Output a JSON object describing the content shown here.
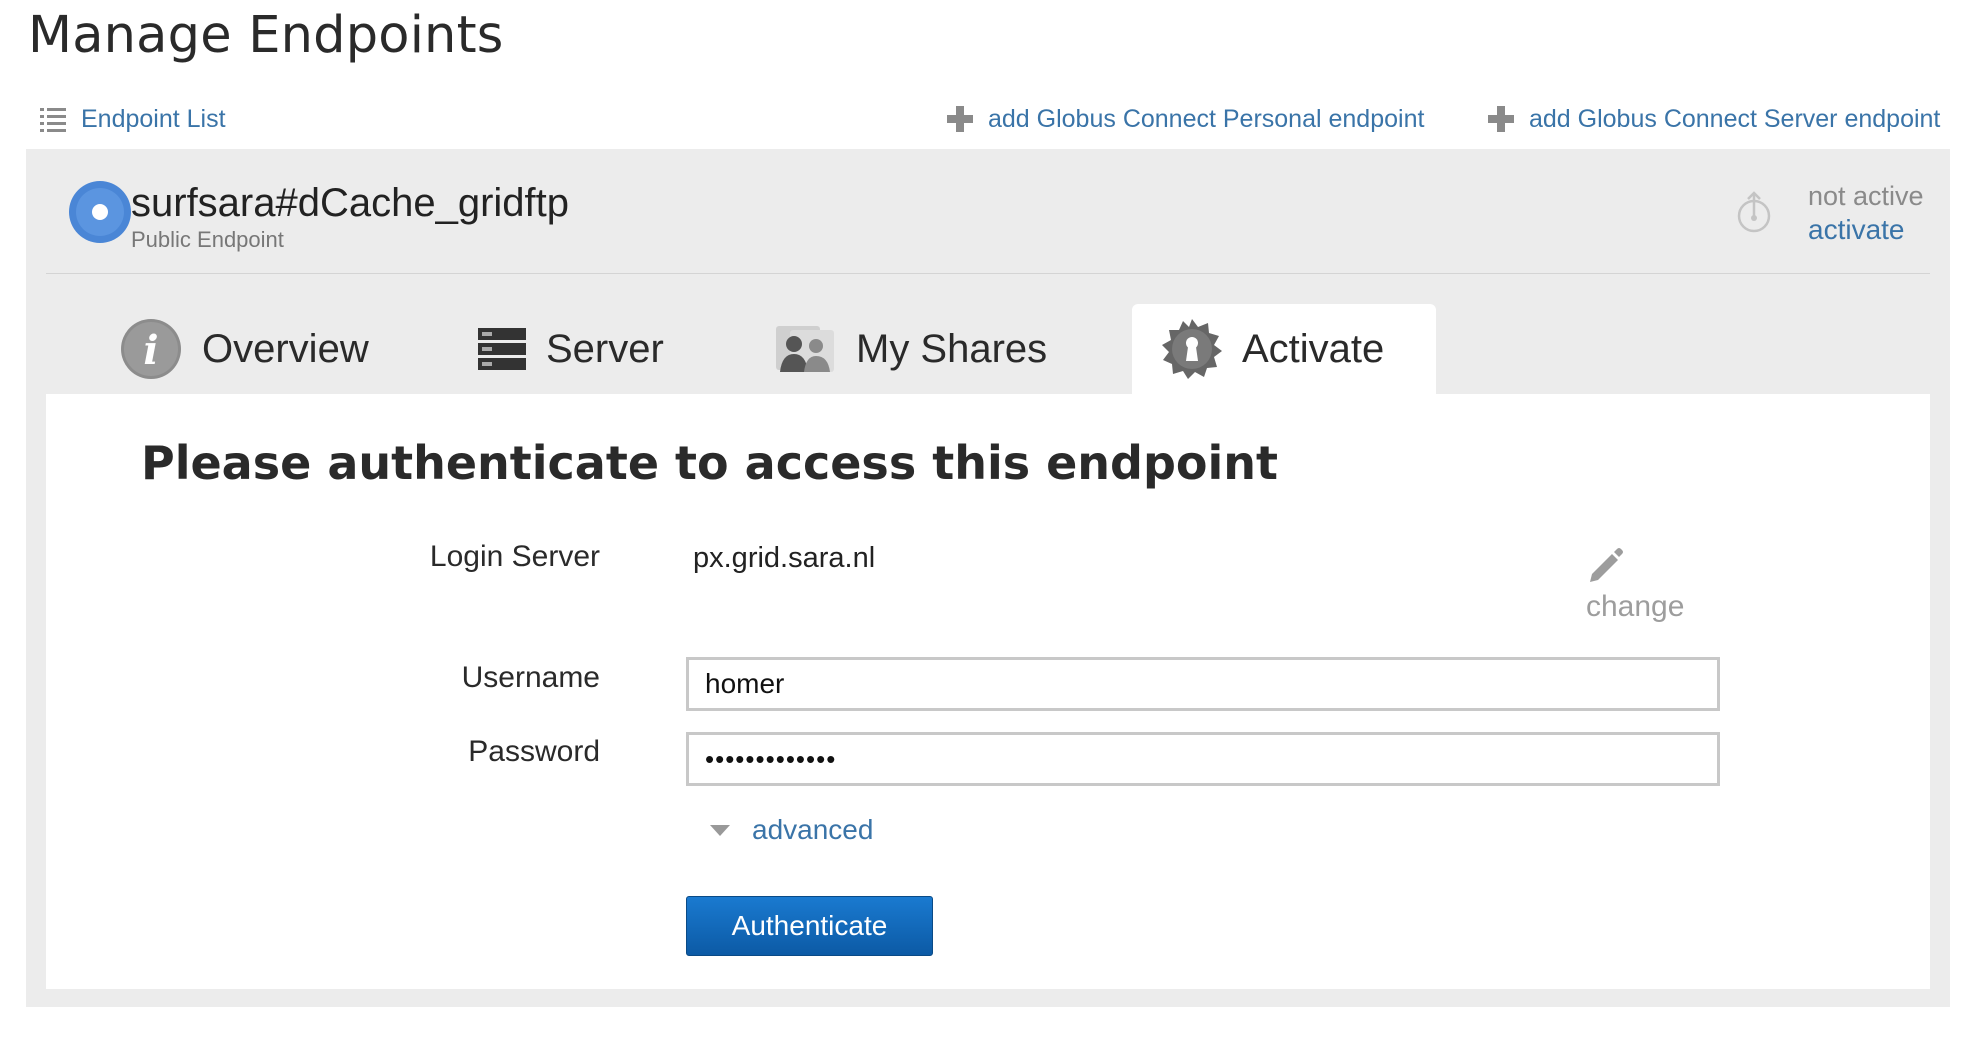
{
  "page": {
    "title": "Manage Endpoints"
  },
  "toplinks": {
    "endpoint_list": "Endpoint List",
    "add_personal": "add Globus Connect Personal endpoint",
    "add_server": "add Globus Connect Server endpoint"
  },
  "endpoint": {
    "name": "surfsara#dCache_gridftp",
    "type": "Public Endpoint",
    "status": "not active",
    "activate_link": "activate"
  },
  "tabs": [
    {
      "label": "Overview",
      "icon": "info-icon",
      "active": false
    },
    {
      "label": "Server",
      "icon": "server-icon",
      "active": false
    },
    {
      "label": "My Shares",
      "icon": "shares-icon",
      "active": false
    },
    {
      "label": "Activate",
      "icon": "activate-badge-icon",
      "active": true
    }
  ],
  "auth": {
    "title": "Please authenticate to access this endpoint",
    "login_server_label": "Login Server",
    "login_server_value": "px.grid.sara.nl",
    "change_label": "change",
    "username_label": "Username",
    "username_value": "homer",
    "password_label": "Password",
    "password_value": "•••••••••••••",
    "advanced_label": "advanced",
    "submit_label": "Authenticate"
  },
  "colors": {
    "link": "#3a74a8",
    "panel_bg": "#ececec",
    "button": "#1a6fc0",
    "globe": "#4a86d6"
  }
}
